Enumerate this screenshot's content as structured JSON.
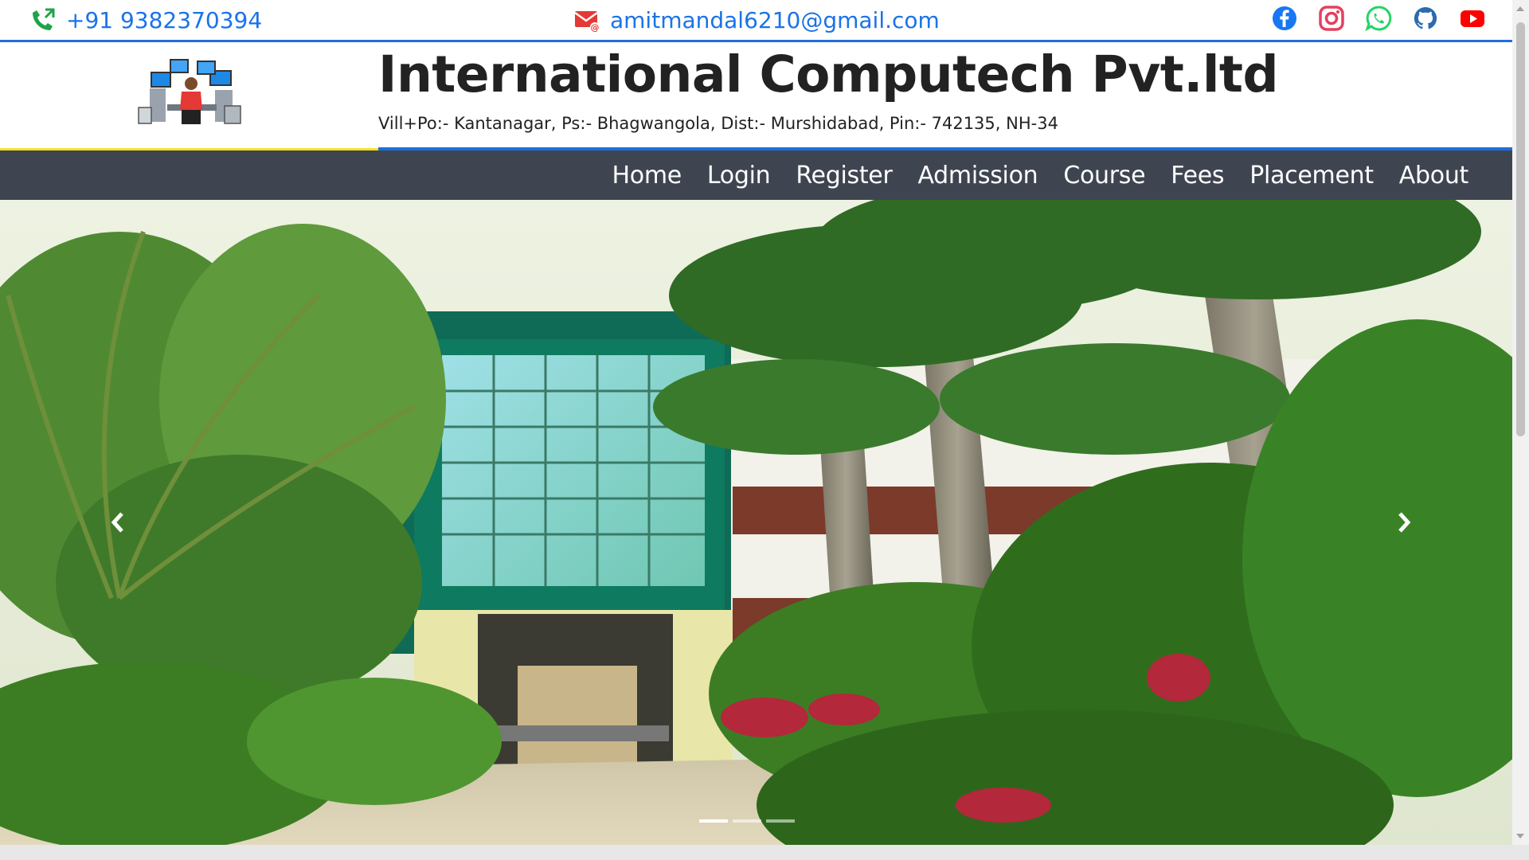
{
  "contact": {
    "phone": "+91 9382370394",
    "email": "amitmandal6210@gmail.com",
    "phone_icon": "phone-icon",
    "email_icon": "envelope-icon"
  },
  "social": [
    "facebook-icon",
    "instagram-icon",
    "whatsapp-icon",
    "github-icon",
    "youtube-icon"
  ],
  "header": {
    "title": "International Computech Pvt.ltd",
    "address": "Vill+Po:- Kantanagar, Ps:- Bhagwangola, Dist:- Murshidabad, Pin:- 742135, NH-34",
    "logo": "computer-lab-logo"
  },
  "nav": {
    "items": [
      "Home",
      "Login",
      "Register",
      "Admission",
      "Course",
      "Fees",
      "Placement",
      "About"
    ]
  },
  "hero": {
    "image": "campus building with palm trees",
    "prev_icon": "chevron-left-icon",
    "next_icon": "chevron-right-icon",
    "slides": 3,
    "active_slide": 1
  },
  "colors": {
    "accent_blue": "#1e6fd9",
    "link_blue": "#1a73e8",
    "accent_yellow": "#f5e12a",
    "navbar": "#3f4550"
  }
}
